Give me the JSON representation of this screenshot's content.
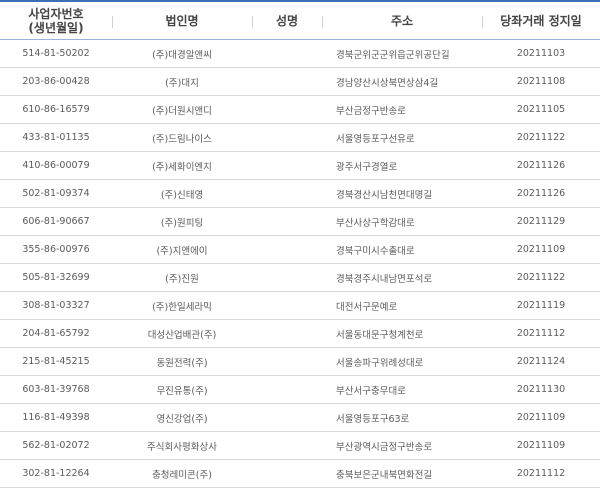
{
  "headers": {
    "col1_line1": "사업자번호",
    "col1_line2": "(생년월일)",
    "col2": "법인명",
    "col3": "성명",
    "col4": "주소",
    "col5": "당좌거래 정지일"
  },
  "rows": [
    {
      "bizno": "514-81-50202",
      "name": "(주)대경알앤씨",
      "rep": "",
      "addr": "경북군위군군위읍군위공단길",
      "date": "20211103"
    },
    {
      "bizno": "203-86-00428",
      "name": "(주)대지",
      "rep": "",
      "addr": "경남양산시상북면상삼4길",
      "date": "20211108"
    },
    {
      "bizno": "610-86-16579",
      "name": "(주)더원시앤디",
      "rep": "",
      "addr": "부산금정구반송로",
      "date": "20211105"
    },
    {
      "bizno": "433-81-01135",
      "name": "(주)드림나이스",
      "rep": "",
      "addr": "서울영등포구선유로",
      "date": "20211122"
    },
    {
      "bizno": "410-86-00079",
      "name": "(주)세화이엔지",
      "rep": "",
      "addr": "광주서구경열로",
      "date": "20211126"
    },
    {
      "bizno": "502-81-09374",
      "name": "(주)신태영",
      "rep": "",
      "addr": "경북경산시남천면대명길",
      "date": "20211126"
    },
    {
      "bizno": "606-81-90667",
      "name": "(주)원피팅",
      "rep": "",
      "addr": "부산사상구학감대로",
      "date": "20211129"
    },
    {
      "bizno": "355-86-00976",
      "name": "(주)지앤에이",
      "rep": "",
      "addr": "경북구미시수출대로",
      "date": "20211109"
    },
    {
      "bizno": "505-81-32699",
      "name": "(주)진원",
      "rep": "",
      "addr": "경북경주시내남면포석로",
      "date": "20211122"
    },
    {
      "bizno": "308-81-03327",
      "name": "(주)한일세라믹",
      "rep": "",
      "addr": "대전서구문예로",
      "date": "20211119"
    },
    {
      "bizno": "204-81-65792",
      "name": "대성산업배관(주)",
      "rep": "",
      "addr": "서울동대문구청계천로",
      "date": "20211112"
    },
    {
      "bizno": "215-81-45215",
      "name": "동원전력(주)",
      "rep": "",
      "addr": "서울송파구위례성대로",
      "date": "20211124"
    },
    {
      "bizno": "603-81-39768",
      "name": "무진유통(주)",
      "rep": "",
      "addr": "부산서구충무대로",
      "date": "20211130"
    },
    {
      "bizno": "116-81-49398",
      "name": "영신강업(주)",
      "rep": "",
      "addr": "서울영등포구63로",
      "date": "20211109"
    },
    {
      "bizno": "562-81-02072",
      "name": "주식회사평화상사",
      "rep": "",
      "addr": "부산광역시금정구반송로",
      "date": "20211109"
    },
    {
      "bizno": "302-81-12264",
      "name": "충청레미콘(주)",
      "rep": "",
      "addr": "충북보은군내북면화전길",
      "date": "20211112"
    }
  ],
  "colors": {
    "header_rule": "#3a6fb7",
    "row_rule": "#d9dde3"
  }
}
